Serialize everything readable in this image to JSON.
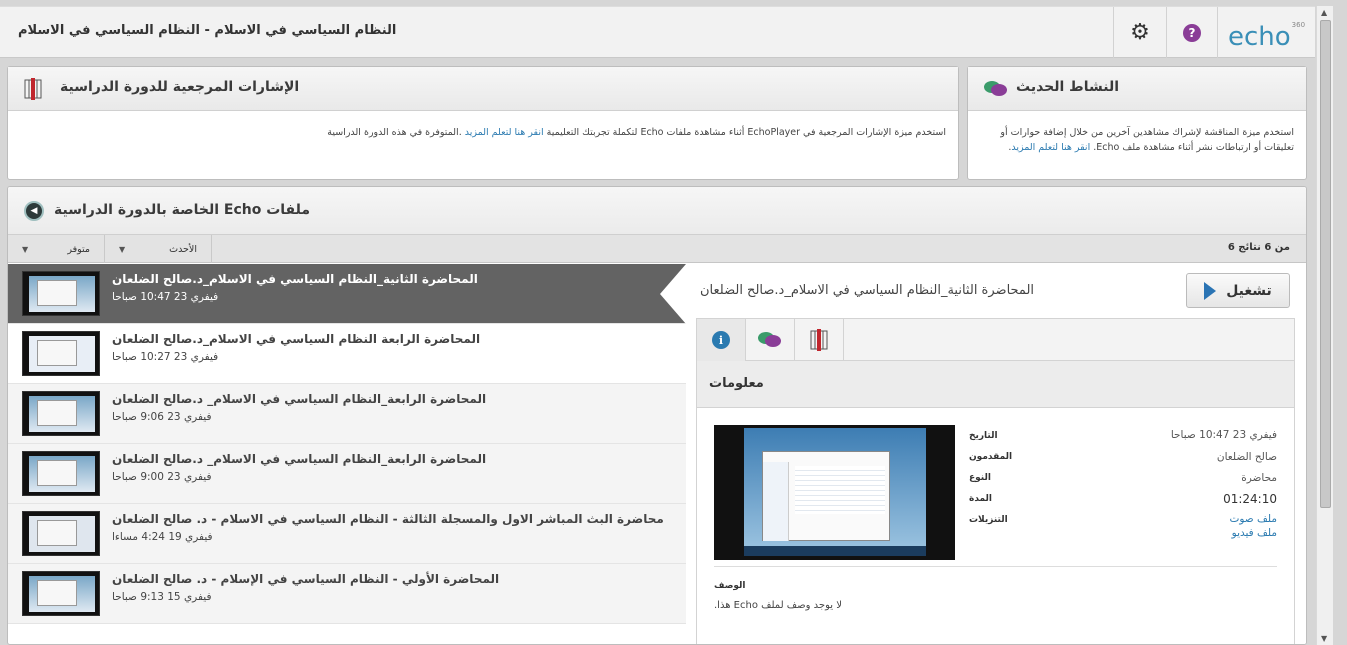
{
  "header": {
    "title": "النظام السياسي في الاسلام - النظام السياسي في الاسلام",
    "logo": "echo",
    "logo_sup": "360",
    "settings_icon": "gear-icon",
    "help_icon": "help-icon",
    "help_glyph": "?"
  },
  "references_panel": {
    "title": "الإشارات المرجعية للدورة الدراسية",
    "icon": "bookmark-icon",
    "text_before": "استخدم ميزة الإشارات المرجعية في EchoPlayer أثناء مشاهدة ملفات Echo لتكملة تجربتك التعليمية",
    "link": "انقر هنا لتعلم المزيد",
    "text_after": ".المتوفرة في هذه الدورة الدراسية"
  },
  "activity_panel": {
    "title": "النشاط الحديث",
    "icon": "discussion-icon",
    "text_before": "استخدم ميزة المناقشة لإشراك مشاهدين آخرين من خلال إضافة حوارات أو تعليقات أو ارتباطات نشر أثناء مشاهدة ملف Echo.",
    "link": "انقر هنا لتعلم المزيد",
    "text_after": "."
  },
  "files_panel": {
    "title": "ملفات Echo الخاصة بالدورة الدراسية",
    "back_icon": "back-circle-icon",
    "back_glyph": "◀",
    "results": "من 6 نتائج 6",
    "filter_available": "متوفر",
    "filter_sort": "الأحدث",
    "caret": "▼"
  },
  "items": [
    {
      "title": "المحاضرة الثانية_النظام السياسي في الاسلام_د.صالح الضلعان",
      "date": "فيفري 23 10:47 صباحا"
    },
    {
      "title": "المحاضرة الرابعة النظام السياسي في الاسلام_د.صالح الضلعان",
      "date": "فيفري 23 10:27 صباحا"
    },
    {
      "title": "المحاضرة الرابعة_النظام السياسي في الاسلام_ د.صالح الضلعان",
      "date": "فيفري 23 9:06 صباحا"
    },
    {
      "title": "المحاضرة الرابعة_النظام السياسي في الاسلام_ د.صالح الضلعان",
      "date": "فيفري 23 9:00 صباحا"
    },
    {
      "title": "محاضرة البث المباشر الاول والمسجلة الثالثة - النظام السياسي في الاسلام - د. صالح الضلعان",
      "date": "فيفري 19 4:24 مساءا"
    },
    {
      "title": "المحاضرة الأولي - النظام السياسي في الإسلام - د. صالح الضلعان",
      "date": "فيفري 15 9:13 صباحا"
    }
  ],
  "detail": {
    "play_label": "تشغيل",
    "title": "المحاضرة الثانية_النظام السياسي في الاسلام_د.صالح الضلعان",
    "tabs": [
      "info-icon",
      "discussion-icon",
      "bookmark-icon"
    ],
    "info_glyph": "i",
    "info_heading": "معلومات",
    "labels": {
      "date": "التاريخ",
      "presenter": "المقدمون",
      "type": "النوع",
      "duration": "المدة",
      "downloads": "التنزيلات"
    },
    "values": {
      "date": "فيفري 23 10:47 صباحا",
      "presenter": "صالح الضلعان",
      "type": "محاضرة",
      "duration": "01:24:10",
      "download_audio": "ملف صوت",
      "download_video": "ملف فيديو"
    },
    "description_label": "الوصف",
    "description_value": "لا يوجد وصف لملف Echo هذا."
  },
  "colors": {
    "accent": "#2a7ab0",
    "selected_row": "#636363",
    "help": "#8a3d97"
  }
}
